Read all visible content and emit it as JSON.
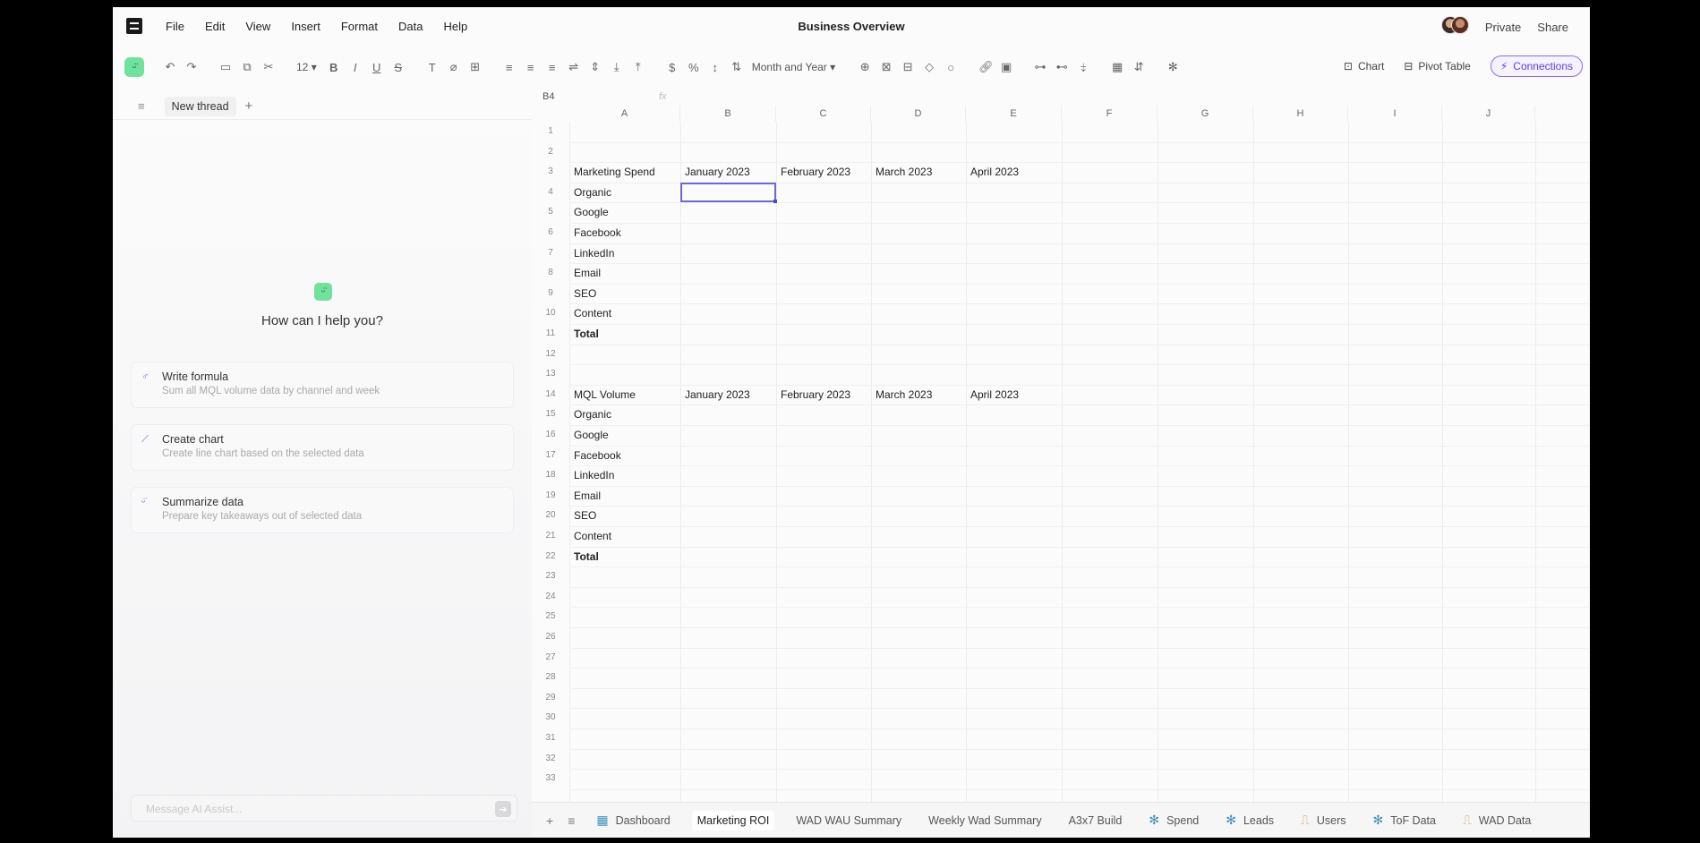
{
  "app": {
    "title": "Business Overview",
    "menu": [
      "File",
      "Edit",
      "View",
      "Insert",
      "Format",
      "Data",
      "Help"
    ],
    "private_label": "Private",
    "share_label": "Share"
  },
  "toolbar": {
    "font_size": "12",
    "number_format": "Month and Year",
    "chart_label": "Chart",
    "pivot_label": "Pivot Table",
    "connections_label": "Connections",
    "accent_color": "#5b3ee0"
  },
  "left_panel": {
    "thread_label": "New thread",
    "prompt": "How can I help you?",
    "suggestions": [
      {
        "title": "Write formula",
        "subtitle": "Sum all MQL volume data by channel and week"
      },
      {
        "title": "Create chart",
        "subtitle": "Create line chart based on the selected data"
      },
      {
        "title": "Summarize data",
        "subtitle": "Prepare key takeaways out of selected data"
      }
    ],
    "message_placeholder": "Message AI Assist..."
  },
  "formula_bar": {
    "cell_ref": "B4",
    "fx": "fx"
  },
  "grid": {
    "columns": [
      "A",
      "B",
      "C",
      "D",
      "E",
      "F",
      "G",
      "H",
      "I",
      "J"
    ],
    "row_count": 33,
    "selected_cell": "B4",
    "cells": {
      "A3": "Marketing Spend",
      "B3": "January 2023",
      "C3": "February 2023",
      "D3": "March 2023",
      "E3": "April 2023",
      "A4": "Organic",
      "A5": "Google",
      "A6": "Facebook",
      "A7": "LinkedIn",
      "A8": "Email",
      "A9": "SEO",
      "A10": "Content",
      "A11": "Total",
      "A14": "MQL Volume",
      "B14": "January 2023",
      "C14": "February 2023",
      "D14": "March 2023",
      "E14": "April 2023",
      "A15": "Organic",
      "A16": "Google",
      "A17": "Facebook",
      "A18": "LinkedIn",
      "A19": "Email",
      "A20": "SEO",
      "A21": "Content",
      "A22": "Total"
    },
    "bold_cells": [
      "A11",
      "A22"
    ]
  },
  "sheet_tabs": {
    "active": "Marketing ROI",
    "tabs": [
      {
        "label": "Dashboard",
        "icon": "dashboard-icon"
      },
      {
        "label": "Marketing ROI",
        "icon": ""
      },
      {
        "label": "WAD WAU Summary",
        "icon": ""
      },
      {
        "label": "Weekly Wad Summary",
        "icon": ""
      },
      {
        "label": "A3x7 Build",
        "icon": ""
      },
      {
        "label": "Spend",
        "icon": "connector-icon"
      },
      {
        "label": "Leads",
        "icon": "connector-icon"
      },
      {
        "label": "Users",
        "icon": "table-icon"
      },
      {
        "label": "ToF Data",
        "icon": "connector-icon"
      },
      {
        "label": "WAD Data",
        "icon": "table-icon"
      }
    ]
  }
}
